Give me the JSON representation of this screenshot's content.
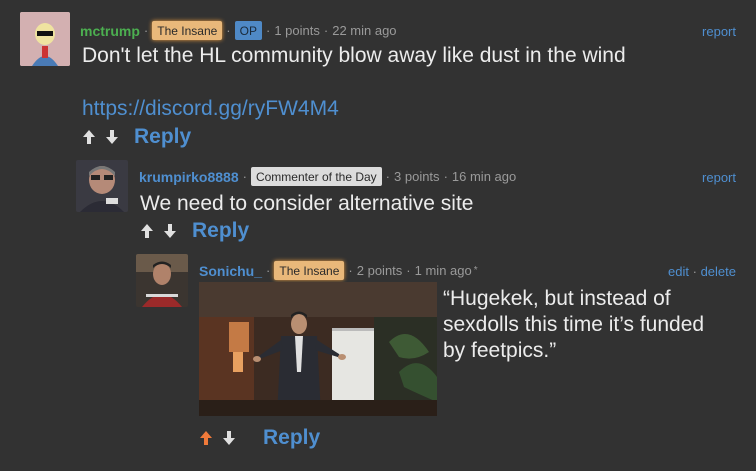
{
  "comments": [
    {
      "user": "mctrump",
      "user_color": "#4caf50",
      "flair": "The Insane",
      "badge": "OP",
      "points": "1 points",
      "time": "22 min ago",
      "action": "report",
      "text": "Don't let the HL community blow away like dust in the wind",
      "link": "https://discord.gg/ryFW4M4",
      "reply": "Reply"
    },
    {
      "user": "krumpirko8888",
      "user_color": "#4f8fd0",
      "flair": "Commenter of the Day",
      "points": "3 points",
      "time": "16 min ago",
      "action": "report",
      "text": "We need to consider alternative site",
      "reply": "Reply"
    },
    {
      "user": "Sonichu_",
      "user_color": "#4f8fd0",
      "flair": "The Insane",
      "points": "2 points",
      "time": "1 min ago",
      "edited_mark": "*",
      "edit": "edit",
      "delete": "delete",
      "text": "“Hugekek, but instead of sexdolls this time it’s funded by feetpics.”",
      "reply": "Reply"
    }
  ],
  "colors": {
    "accent": "#4f8fd0",
    "upvoted": "#f07a3a",
    "background": "#323232"
  }
}
